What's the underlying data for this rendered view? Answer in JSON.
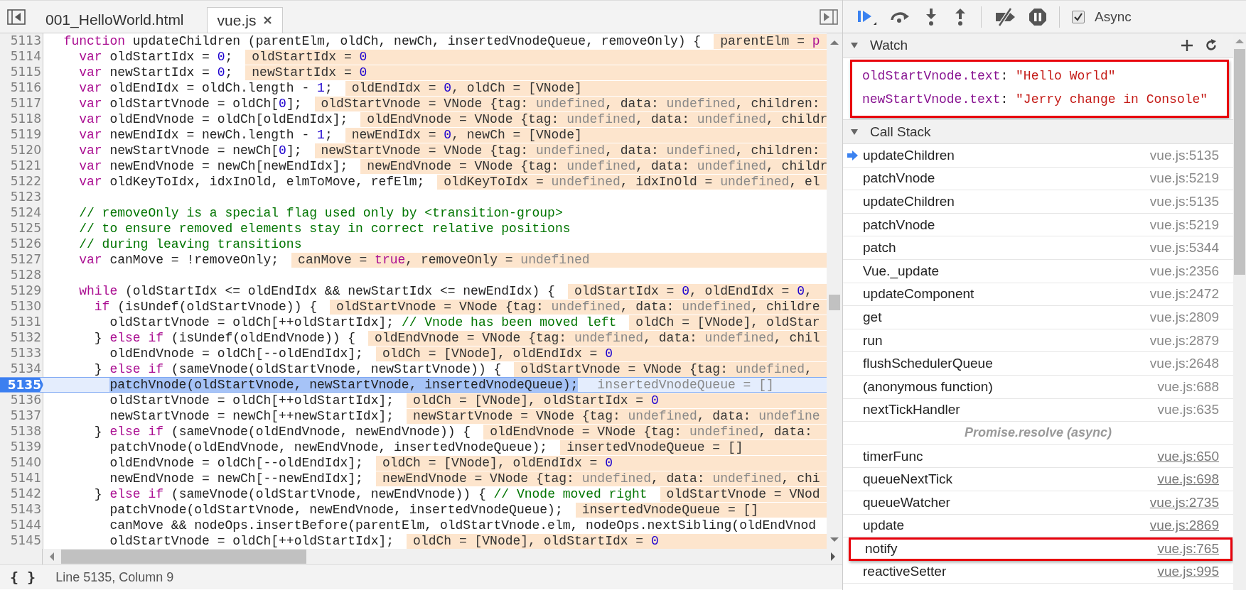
{
  "editor": {
    "tabs": [
      {
        "label": "001_HelloWorld.html",
        "selected": false,
        "closable": false
      },
      {
        "label": "vue.js",
        "selected": true,
        "closable": true
      }
    ],
    "lines": [
      {
        "number": "5113",
        "current": false,
        "code": [
          {
            "kind": "keyword",
            "text": "  function"
          },
          {
            "kind": "plain",
            "text": " updateChildren (parentElm, oldCh, newCh, insertedVnodeQueue, removeOnly) {"
          }
        ],
        "values": [
          {
            "kind": "plain",
            "text": "parentElm = "
          },
          {
            "kind": "literal",
            "text": "p"
          }
        ]
      },
      {
        "number": "5114",
        "current": false,
        "code": [
          {
            "kind": "keyword",
            "text": "    var"
          },
          {
            "kind": "plain",
            "text": " oldStartIdx = "
          },
          {
            "kind": "number",
            "text": "0"
          },
          {
            "kind": "plain",
            "text": ";"
          }
        ],
        "values": [
          {
            "kind": "plain",
            "text": "oldStartIdx = "
          },
          {
            "kind": "number",
            "text": "0"
          }
        ]
      },
      {
        "number": "5115",
        "current": false,
        "code": [
          {
            "kind": "keyword",
            "text": "    var"
          },
          {
            "kind": "plain",
            "text": " newStartIdx = "
          },
          {
            "kind": "number",
            "text": "0"
          },
          {
            "kind": "plain",
            "text": ";"
          }
        ],
        "values": [
          {
            "kind": "plain",
            "text": "newStartIdx = "
          },
          {
            "kind": "number",
            "text": "0"
          }
        ]
      },
      {
        "number": "5116",
        "current": false,
        "code": [
          {
            "kind": "keyword",
            "text": "    var"
          },
          {
            "kind": "plain",
            "text": " oldEndIdx = oldCh.length - "
          },
          {
            "kind": "number",
            "text": "1"
          },
          {
            "kind": "plain",
            "text": ";"
          }
        ],
        "values": [
          {
            "kind": "plain",
            "text": "oldEndIdx = "
          },
          {
            "kind": "number",
            "text": "0"
          },
          {
            "kind": "plain",
            "text": ", oldCh = [VNode]"
          }
        ]
      },
      {
        "number": "5117",
        "current": false,
        "code": [
          {
            "kind": "keyword",
            "text": "    var"
          },
          {
            "kind": "plain",
            "text": " oldStartVnode = oldCh["
          },
          {
            "kind": "number",
            "text": "0"
          },
          {
            "kind": "plain",
            "text": "];"
          }
        ],
        "values": [
          {
            "kind": "plain",
            "text": "oldStartVnode = VNode {tag: "
          },
          {
            "kind": "undefined",
            "text": "undefined"
          },
          {
            "kind": "plain",
            "text": ", data: "
          },
          {
            "kind": "undefined",
            "text": "undefined"
          },
          {
            "kind": "plain",
            "text": ", children:"
          }
        ]
      },
      {
        "number": "5118",
        "current": false,
        "code": [
          {
            "kind": "keyword",
            "text": "    var"
          },
          {
            "kind": "plain",
            "text": " oldEndVnode = oldCh[oldEndIdx];"
          }
        ],
        "values": [
          {
            "kind": "plain",
            "text": "oldEndVnode = VNode {tag: "
          },
          {
            "kind": "undefined",
            "text": "undefined"
          },
          {
            "kind": "plain",
            "text": ", data: "
          },
          {
            "kind": "undefined",
            "text": "undefined"
          },
          {
            "kind": "plain",
            "text": ", childr"
          }
        ]
      },
      {
        "number": "5119",
        "current": false,
        "code": [
          {
            "kind": "keyword",
            "text": "    var"
          },
          {
            "kind": "plain",
            "text": " newEndIdx = newCh.length - "
          },
          {
            "kind": "number",
            "text": "1"
          },
          {
            "kind": "plain",
            "text": ";"
          }
        ],
        "values": [
          {
            "kind": "plain",
            "text": "newEndIdx = "
          },
          {
            "kind": "number",
            "text": "0"
          },
          {
            "kind": "plain",
            "text": ", newCh = [VNode]"
          }
        ]
      },
      {
        "number": "5120",
        "current": false,
        "code": [
          {
            "kind": "keyword",
            "text": "    var"
          },
          {
            "kind": "plain",
            "text": " newStartVnode = newCh["
          },
          {
            "kind": "number",
            "text": "0"
          },
          {
            "kind": "plain",
            "text": "];"
          }
        ],
        "values": [
          {
            "kind": "plain",
            "text": "newStartVnode = VNode {tag: "
          },
          {
            "kind": "undefined",
            "text": "undefined"
          },
          {
            "kind": "plain",
            "text": ", data: "
          },
          {
            "kind": "undefined",
            "text": "undefined"
          },
          {
            "kind": "plain",
            "text": ", children:"
          }
        ]
      },
      {
        "number": "5121",
        "current": false,
        "code": [
          {
            "kind": "keyword",
            "text": "    var"
          },
          {
            "kind": "plain",
            "text": " newEndVnode = newCh[newEndIdx];"
          }
        ],
        "values": [
          {
            "kind": "plain",
            "text": "newEndVnode = VNode {tag: "
          },
          {
            "kind": "undefined",
            "text": "undefined"
          },
          {
            "kind": "plain",
            "text": ", data: "
          },
          {
            "kind": "undefined",
            "text": "undefined"
          },
          {
            "kind": "plain",
            "text": ", childr"
          }
        ]
      },
      {
        "number": "5122",
        "current": false,
        "code": [
          {
            "kind": "keyword",
            "text": "    var"
          },
          {
            "kind": "plain",
            "text": " oldKeyToIdx, idxInOld, elmToMove, refElm;"
          }
        ],
        "values": [
          {
            "kind": "plain",
            "text": "oldKeyToIdx = "
          },
          {
            "kind": "undefined",
            "text": "undefined"
          },
          {
            "kind": "plain",
            "text": ", idxInOld = "
          },
          {
            "kind": "undefined",
            "text": "undefined"
          },
          {
            "kind": "plain",
            "text": ", el"
          }
        ]
      },
      {
        "number": "5123",
        "current": false
      },
      {
        "number": "5124",
        "current": false,
        "code": [
          {
            "kind": "comment",
            "text": "    // removeOnly is a special flag used only by <transition-group>"
          }
        ]
      },
      {
        "number": "5125",
        "current": false,
        "code": [
          {
            "kind": "comment",
            "text": "    // to ensure removed elements stay in correct relative positions"
          }
        ]
      },
      {
        "number": "5126",
        "current": false,
        "code": [
          {
            "kind": "comment",
            "text": "    // during leaving transitions"
          }
        ]
      },
      {
        "number": "5127",
        "current": false,
        "code": [
          {
            "kind": "keyword",
            "text": "    var"
          },
          {
            "kind": "plain",
            "text": " canMove = !removeOnly;"
          }
        ],
        "values": [
          {
            "kind": "plain",
            "text": "canMove = "
          },
          {
            "kind": "literal",
            "text": "true"
          },
          {
            "kind": "plain",
            "text": ", removeOnly = "
          },
          {
            "kind": "undefined",
            "text": "undefined"
          }
        ]
      },
      {
        "number": "5128",
        "current": false
      },
      {
        "number": "5129",
        "current": false,
        "code": [
          {
            "kind": "keyword",
            "text": "    while"
          },
          {
            "kind": "plain",
            "text": " (oldStartIdx <= oldEndIdx && newStartIdx <= newEndIdx) {"
          }
        ],
        "values": [
          {
            "kind": "plain",
            "text": "oldStartIdx = "
          },
          {
            "kind": "number",
            "text": "0"
          },
          {
            "kind": "plain",
            "text": ", oldEndIdx = "
          },
          {
            "kind": "number",
            "text": "0"
          },
          {
            "kind": "plain",
            "text": ","
          }
        ]
      },
      {
        "number": "5130",
        "current": false,
        "code": [
          {
            "kind": "keyword",
            "text": "      if"
          },
          {
            "kind": "plain",
            "text": " (isUndef(oldStartVnode)) {"
          }
        ],
        "values": [
          {
            "kind": "plain",
            "text": "oldStartVnode = VNode {tag: "
          },
          {
            "kind": "undefined",
            "text": "undefined"
          },
          {
            "kind": "plain",
            "text": ", data: "
          },
          {
            "kind": "undefined",
            "text": "undefined"
          },
          {
            "kind": "plain",
            "text": ", childre"
          }
        ]
      },
      {
        "number": "5131",
        "current": false,
        "code": [
          {
            "kind": "plain",
            "text": "        oldStartVnode = oldCh[++oldStartIdx]; "
          },
          {
            "kind": "comment",
            "text": "// Vnode has been moved left"
          }
        ],
        "values": [
          {
            "kind": "plain",
            "text": "oldCh = [VNode], oldStar"
          }
        ]
      },
      {
        "number": "5132",
        "current": false,
        "code": [
          {
            "kind": "plain",
            "text": "      } "
          },
          {
            "kind": "keyword",
            "text": "else if"
          },
          {
            "kind": "plain",
            "text": " (isUndef(oldEndVnode)) {"
          }
        ],
        "values": [
          {
            "kind": "plain",
            "text": "oldEndVnode = VNode {tag: "
          },
          {
            "kind": "undefined",
            "text": "undefined"
          },
          {
            "kind": "plain",
            "text": ", data: "
          },
          {
            "kind": "undefined",
            "text": "undefined"
          },
          {
            "kind": "plain",
            "text": ", chil"
          }
        ]
      },
      {
        "number": "5133",
        "current": false,
        "code": [
          {
            "kind": "plain",
            "text": "        oldEndVnode = oldCh[--oldEndIdx];"
          }
        ],
        "values": [
          {
            "kind": "plain",
            "text": "oldCh = [VNode], oldEndIdx = "
          },
          {
            "kind": "number",
            "text": "0"
          }
        ]
      },
      {
        "number": "5134",
        "current": false,
        "code": [
          {
            "kind": "plain",
            "text": "      } "
          },
          {
            "kind": "keyword",
            "text": "else if"
          },
          {
            "kind": "plain",
            "text": " (sameVnode(oldStartVnode, newStartVnode)) {"
          }
        ],
        "values": [
          {
            "kind": "plain",
            "text": "oldStartVnode = VNode {tag: "
          },
          {
            "kind": "undefined",
            "text": "undefined"
          },
          {
            "kind": "plain",
            "text": ","
          }
        ]
      },
      {
        "number": "5135",
        "current": true,
        "code": [
          {
            "kind": "plain",
            "text": "patchVnode(oldStartVnode, newStartVnode, insertedVnodeQueue);"
          }
        ],
        "values": [
          {
            "kind": "plain",
            "text": "insertedVnodeQueue = []"
          }
        ]
      },
      {
        "number": "5136",
        "current": false,
        "code": [
          {
            "kind": "plain",
            "text": "        oldStartVnode = oldCh[++oldStartIdx];"
          }
        ],
        "values": [
          {
            "kind": "plain",
            "text": "oldCh = [VNode], oldStartIdx = "
          },
          {
            "kind": "number",
            "text": "0"
          }
        ]
      },
      {
        "number": "5137",
        "current": false,
        "code": [
          {
            "kind": "plain",
            "text": "        newStartVnode = newCh[++newStartIdx];"
          }
        ],
        "values": [
          {
            "kind": "plain",
            "text": "newStartVnode = VNode {tag: "
          },
          {
            "kind": "undefined",
            "text": "undefined"
          },
          {
            "kind": "plain",
            "text": ", data: "
          },
          {
            "kind": "undefined",
            "text": "undefine"
          }
        ]
      },
      {
        "number": "5138",
        "current": false,
        "code": [
          {
            "kind": "plain",
            "text": "      } "
          },
          {
            "kind": "keyword",
            "text": "else if"
          },
          {
            "kind": "plain",
            "text": " (sameVnode(oldEndVnode, newEndVnode)) {"
          }
        ],
        "values": [
          {
            "kind": "plain",
            "text": "oldEndVnode = VNode {tag: "
          },
          {
            "kind": "undefined",
            "text": "undefined"
          },
          {
            "kind": "plain",
            "text": ", data:"
          }
        ]
      },
      {
        "number": "5139",
        "current": false,
        "code": [
          {
            "kind": "plain",
            "text": "        patchVnode(oldEndVnode, newEndVnode, insertedVnodeQueue);"
          }
        ],
        "values": [
          {
            "kind": "plain",
            "text": "insertedVnodeQueue = []"
          }
        ]
      },
      {
        "number": "5140",
        "current": false,
        "code": [
          {
            "kind": "plain",
            "text": "        oldEndVnode = oldCh[--oldEndIdx];"
          }
        ],
        "values": [
          {
            "kind": "plain",
            "text": "oldCh = [VNode], oldEndIdx = "
          },
          {
            "kind": "number",
            "text": "0"
          }
        ]
      },
      {
        "number": "5141",
        "current": false,
        "code": [
          {
            "kind": "plain",
            "text": "        newEndVnode = newCh[--newEndIdx];"
          }
        ],
        "values": [
          {
            "kind": "plain",
            "text": "newEndVnode = VNode {tag: "
          },
          {
            "kind": "undefined",
            "text": "undefined"
          },
          {
            "kind": "plain",
            "text": ", data: "
          },
          {
            "kind": "undefined",
            "text": "undefined"
          },
          {
            "kind": "plain",
            "text": ", chi"
          }
        ]
      },
      {
        "number": "5142",
        "current": false,
        "code": [
          {
            "kind": "plain",
            "text": "      } "
          },
          {
            "kind": "keyword",
            "text": "else if"
          },
          {
            "kind": "plain",
            "text": " (sameVnode(oldStartVnode, newEndVnode)) { "
          },
          {
            "kind": "comment",
            "text": "// Vnode moved right"
          }
        ],
        "values": [
          {
            "kind": "plain",
            "text": "oldStartVnode = VNod"
          }
        ]
      },
      {
        "number": "5143",
        "current": false,
        "code": [
          {
            "kind": "plain",
            "text": "        patchVnode(oldStartVnode, newEndVnode, insertedVnodeQueue);"
          }
        ],
        "values": [
          {
            "kind": "plain",
            "text": "insertedVnodeQueue = []"
          }
        ]
      },
      {
        "number": "5144",
        "current": false,
        "code": [
          {
            "kind": "plain",
            "text": "        canMove && nodeOps.insertBefore(parentElm, oldStartVnode.elm, nodeOps.nextSibling(oldEndVnod"
          }
        ]
      },
      {
        "number": "5145",
        "current": false,
        "code": [
          {
            "kind": "plain",
            "text": "        oldStartVnode = oldCh[++oldStartIdx];"
          }
        ],
        "values": [
          {
            "kind": "plain",
            "text": "oldCh = [VNode], oldStartIdx = "
          },
          {
            "kind": "number",
            "text": "0"
          }
        ]
      }
    ],
    "status_bar": {
      "format_button": "{ }",
      "position": "Line 5135, Column 9"
    }
  },
  "debugger": {
    "async": {
      "label": "Async",
      "checked": true
    },
    "watch": {
      "title": "Watch",
      "expanded": true,
      "highlighted": true,
      "expressions": [
        {
          "name": "oldStartVnode.text",
          "separator": ":",
          "value": "\"Hello World\""
        },
        {
          "name": "newStartVnode.text",
          "separator": ":",
          "value": "\"Jerry change in Console\""
        }
      ]
    },
    "call_stack": {
      "title": "Call Stack",
      "expanded": true,
      "frames": [
        {
          "kind": "frame",
          "name": "updateChildren",
          "location": "vue.js:5135",
          "current": true,
          "linked": false,
          "highlighted": false
        },
        {
          "kind": "frame",
          "name": "patchVnode",
          "location": "vue.js:5219",
          "current": false,
          "linked": false,
          "highlighted": false
        },
        {
          "kind": "frame",
          "name": "updateChildren",
          "location": "vue.js:5135",
          "current": false,
          "linked": false,
          "highlighted": false
        },
        {
          "kind": "frame",
          "name": "patchVnode",
          "location": "vue.js:5219",
          "current": false,
          "linked": false,
          "highlighted": false
        },
        {
          "kind": "frame",
          "name": "patch",
          "location": "vue.js:5344",
          "current": false,
          "linked": false,
          "highlighted": false
        },
        {
          "kind": "frame",
          "name": "Vue._update",
          "location": "vue.js:2356",
          "current": false,
          "linked": false,
          "highlighted": false
        },
        {
          "kind": "frame",
          "name": "updateComponent",
          "location": "vue.js:2472",
          "current": false,
          "linked": false,
          "highlighted": false
        },
        {
          "kind": "frame",
          "name": "get",
          "location": "vue.js:2809",
          "current": false,
          "linked": false,
          "highlighted": false
        },
        {
          "kind": "frame",
          "name": "run",
          "location": "vue.js:2879",
          "current": false,
          "linked": false,
          "highlighted": false
        },
        {
          "kind": "frame",
          "name": "flushSchedulerQueue",
          "location": "vue.js:2648",
          "current": false,
          "linked": false,
          "highlighted": false
        },
        {
          "kind": "frame",
          "name": "(anonymous function)",
          "location": "vue.js:688",
          "current": false,
          "linked": false,
          "highlighted": false
        },
        {
          "kind": "frame",
          "name": "nextTickHandler",
          "location": "vue.js:635",
          "current": false,
          "linked": false,
          "highlighted": false
        },
        {
          "kind": "async",
          "label": "Promise.resolve (async)"
        },
        {
          "kind": "frame",
          "name": "timerFunc",
          "location": "vue.js:650",
          "current": false,
          "linked": true,
          "highlighted": false
        },
        {
          "kind": "frame",
          "name": "queueNextTick",
          "location": "vue.js:698",
          "current": false,
          "linked": true,
          "highlighted": false
        },
        {
          "kind": "frame",
          "name": "queueWatcher",
          "location": "vue.js:2735",
          "current": false,
          "linked": true,
          "highlighted": false
        },
        {
          "kind": "frame",
          "name": "update",
          "location": "vue.js:2869",
          "current": false,
          "linked": true,
          "highlighted": false
        },
        {
          "kind": "frame",
          "name": "notify",
          "location": "vue.js:765",
          "current": false,
          "linked": true,
          "highlighted": true
        },
        {
          "kind": "frame",
          "name": "reactiveSetter",
          "location": "vue.js:995",
          "current": false,
          "linked": true,
          "highlighted": false
        }
      ]
    }
  }
}
